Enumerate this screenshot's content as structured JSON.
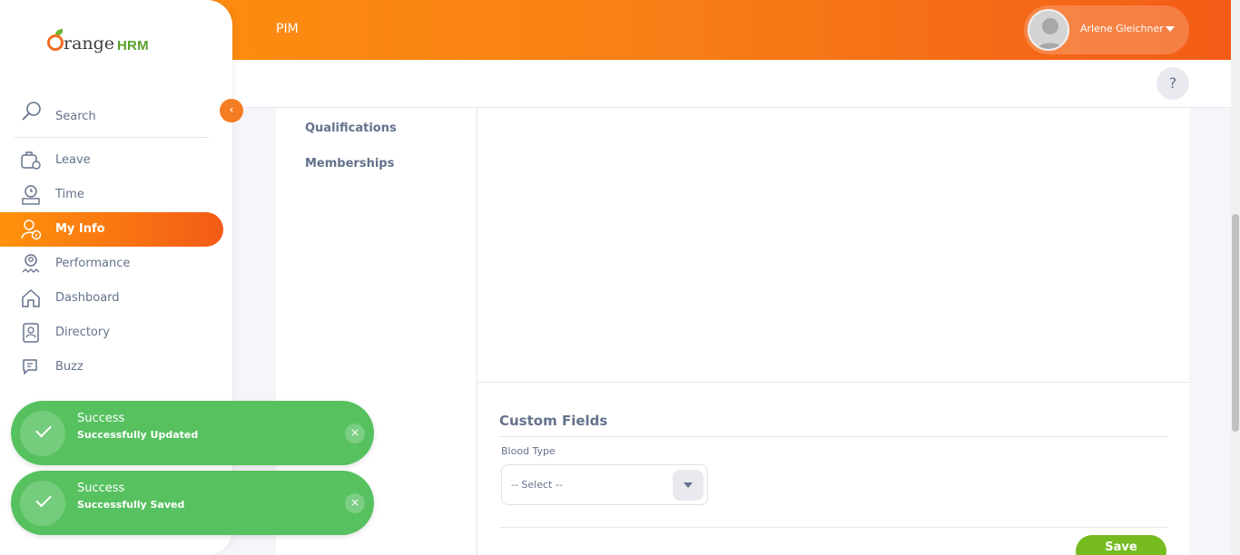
{
  "header": {
    "module_title": "PIM",
    "user_name": "Arlene Gleichner",
    "help_label": "?"
  },
  "brand": {
    "logo_word": "range",
    "logo_hrm": "HRM",
    "accent": "#f47c21",
    "success": "#57c160",
    "save_green": "#76bc21"
  },
  "sidebar": {
    "collapse_icon": "‹",
    "search_label": "Search",
    "items": [
      {
        "label": "Leave",
        "icon": "leave-icon"
      },
      {
        "label": "Time",
        "icon": "time-icon"
      },
      {
        "label": "My Info",
        "icon": "my-info-icon",
        "active": true
      },
      {
        "label": "Performance",
        "icon": "performance-icon"
      },
      {
        "label": "Dashboard",
        "icon": "dashboard-icon"
      },
      {
        "label": "Directory",
        "icon": "directory-icon"
      },
      {
        "label": "Buzz",
        "icon": "buzz-icon"
      }
    ]
  },
  "tabs": {
    "qualifications": "Qualifications",
    "memberships": "Memberships"
  },
  "custom_fields": {
    "title": "Custom Fields",
    "blood_type_label": "Blood Type",
    "blood_type_value": "-- Select --",
    "save_label": "Save"
  },
  "toasts": [
    {
      "title": "Success",
      "message": "Successfully Updated",
      "close": "×"
    },
    {
      "title": "Success",
      "message": "Successfully Saved",
      "close": "×"
    }
  ]
}
